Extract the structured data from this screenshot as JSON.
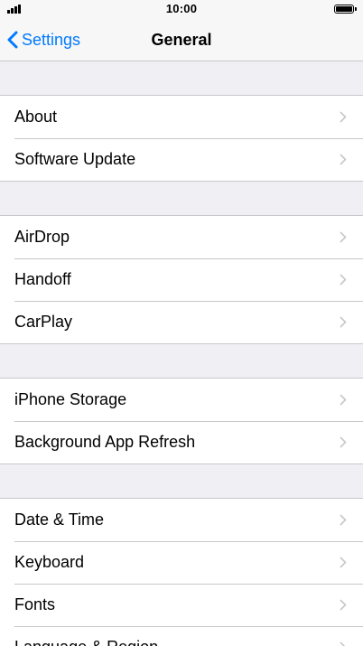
{
  "status_bar": {
    "time": "10:00"
  },
  "nav": {
    "back_label": "Settings",
    "title": "General"
  },
  "groups": [
    {
      "items": [
        {
          "label": "About"
        },
        {
          "label": "Software Update"
        }
      ]
    },
    {
      "items": [
        {
          "label": "AirDrop"
        },
        {
          "label": "Handoff"
        },
        {
          "label": "CarPlay"
        }
      ]
    },
    {
      "items": [
        {
          "label": "iPhone Storage"
        },
        {
          "label": "Background App Refresh"
        }
      ]
    },
    {
      "items": [
        {
          "label": "Date & Time"
        },
        {
          "label": "Keyboard"
        },
        {
          "label": "Fonts"
        },
        {
          "label": "Language & Region"
        }
      ]
    }
  ],
  "colors": {
    "accent": "#007aff",
    "group_background": "#efeff4",
    "separator": "#c8c7cc",
    "chevron": "#c7c7cc"
  }
}
